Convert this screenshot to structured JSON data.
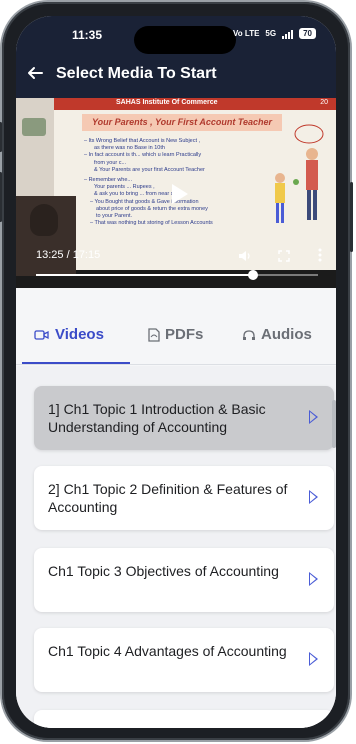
{
  "status": {
    "time": "11:35",
    "network": "Vo LTE",
    "signal": "5G",
    "battery": "70"
  },
  "header": {
    "title": "Select Media To Start"
  },
  "player": {
    "slide_institute": "SAHAS Institute Of Commerce",
    "slide_number": "20",
    "slide_heading": "Your Parents , Your First Account Teacher",
    "slide_lines": [
      "– Its Wrong Belief that Account is New Subject ,",
      "as there was no Base in 10th",
      "– In fact account is th... which u learn Practically",
      "from your c...",
      "& Your Parents are your first Account Teacher",
      "– Remember whe...",
      "Your parents ... Rupees ,",
      "& ask you to bring ... from near shop",
      "– You Bought that goods & Gave information",
      "about price of goods & return the extra money",
      "to your Parent.",
      "– That was nothing but storing of Lesson Accounts"
    ],
    "elapsed": "13:25",
    "duration": "17:15",
    "time_display": "13:25 / 17:15",
    "progress": 0.77
  },
  "tabs": [
    {
      "label": "Videos",
      "icon": "video-icon",
      "active": true
    },
    {
      "label": "PDFs",
      "icon": "pdf-icon",
      "active": false
    },
    {
      "label": "Audios",
      "icon": "headphones-icon",
      "active": false
    }
  ],
  "items": [
    {
      "title": "1] Ch1 Topic 1 Introduction & Basic Understanding of Accounting",
      "selected": true
    },
    {
      "title": "2] Ch1 Topic 2 Definition & Features of Accounting",
      "selected": false
    },
    {
      "title": "Ch1 Topic 3 Objectives of Accounting",
      "selected": false
    },
    {
      "title": "Ch1 Topic 4 Advantages of Accounting",
      "selected": false
    }
  ],
  "colors": {
    "header_bg": "#1a2236",
    "accent": "#3b4cc8",
    "selected_card": "#c9cacd"
  }
}
